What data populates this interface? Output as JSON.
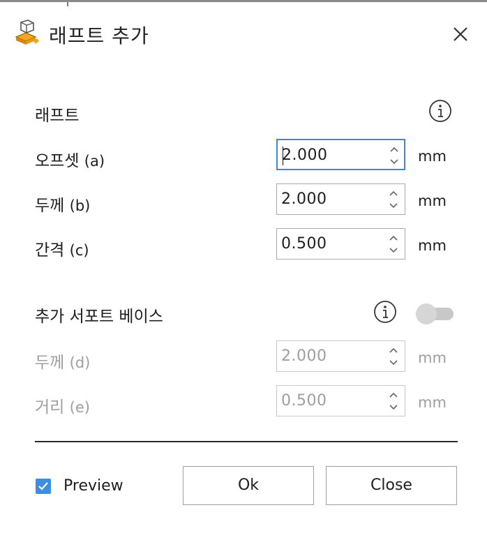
{
  "dialog": {
    "title": "래프트 추가",
    "title_icon": "raft-object-icon",
    "close_icon": "close-icon"
  },
  "raft_section": {
    "heading": "래프트",
    "info_icon": "info-icon",
    "fields": [
      {
        "label": "오프셋",
        "sub": "(a)",
        "value": "2.000",
        "unit": "mm",
        "enabled": true,
        "focused": true
      },
      {
        "label": "두께",
        "sub": "(b)",
        "value": "2.000",
        "unit": "mm",
        "enabled": true,
        "focused": false
      },
      {
        "label": "간격",
        "sub": "(c)",
        "value": "0.500",
        "unit": "mm",
        "enabled": true,
        "focused": false
      }
    ]
  },
  "support_base_section": {
    "heading": "추가 서포트 베이스",
    "info_icon": "info-icon",
    "toggle_on": false,
    "fields": [
      {
        "label": "두께",
        "sub": "(d)",
        "value": "2.000",
        "unit": "mm",
        "enabled": false
      },
      {
        "label": "거리",
        "sub": "(e)",
        "value": "0.500",
        "unit": "mm",
        "enabled": false
      }
    ]
  },
  "footer": {
    "preview_label": "Preview",
    "preview_checked": true,
    "ok_label": "Ok",
    "close_label": "Close"
  },
  "colors": {
    "accent": "#3b8ee0",
    "focus_border": "#3f86d4",
    "disabled_text": "#9e9e9e",
    "icon_orange": "#f5a623"
  }
}
